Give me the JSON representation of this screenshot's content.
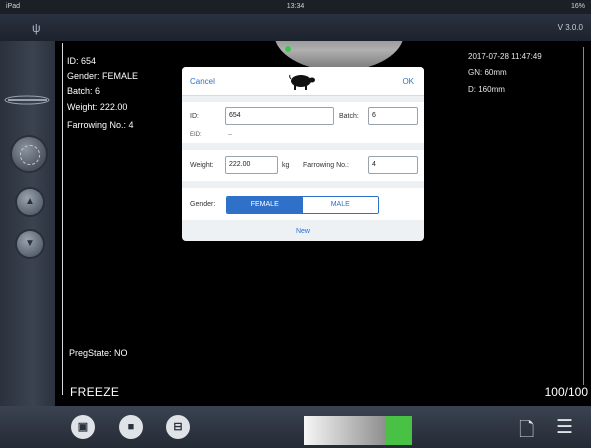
{
  "status_bar": {
    "left": "iPad",
    "time": "13:34",
    "battery": "16%"
  },
  "top_bar": {
    "version": "V 3.0.0"
  },
  "overlay": {
    "id": "ID: 654",
    "gender": "Gender: FEMALE",
    "batch": "Batch: 6",
    "weight": "Weight: 222.00",
    "farrowing": "Farrowing No.: 4",
    "preg_state": "PregState: NO",
    "freeze": "FREEZE",
    "frame_count": "100/100",
    "datetime": "2017-07-28 11:47:49",
    "gn": "GN: 60mm",
    "depth": "D: 160mm"
  },
  "dialog": {
    "cancel_label": "Cancel",
    "ok_label": "OK",
    "id_label": "ID:",
    "id_value": "654",
    "batch_label": "Batch:",
    "batch_value": "6",
    "eid_label": "EID:",
    "eid_value": "--",
    "weight_label": "Weight:",
    "weight_value": "222.00",
    "weight_unit": "kg",
    "farrowing_label": "Farrowing No.:",
    "farrowing_value": "4",
    "gender_label": "Gender:",
    "gender_options": [
      "FEMALE",
      "MALE"
    ],
    "gender_selected": "FEMALE",
    "new_label": "New"
  },
  "bottom_bar": {
    "icons": [
      "gallery-icon",
      "camera-icon",
      "save-icon",
      "file-search-icon",
      "list-icon"
    ],
    "gray_scale_level": 0.75
  },
  "colors": {
    "accent": "#2f70c9",
    "green": "#48c144"
  }
}
